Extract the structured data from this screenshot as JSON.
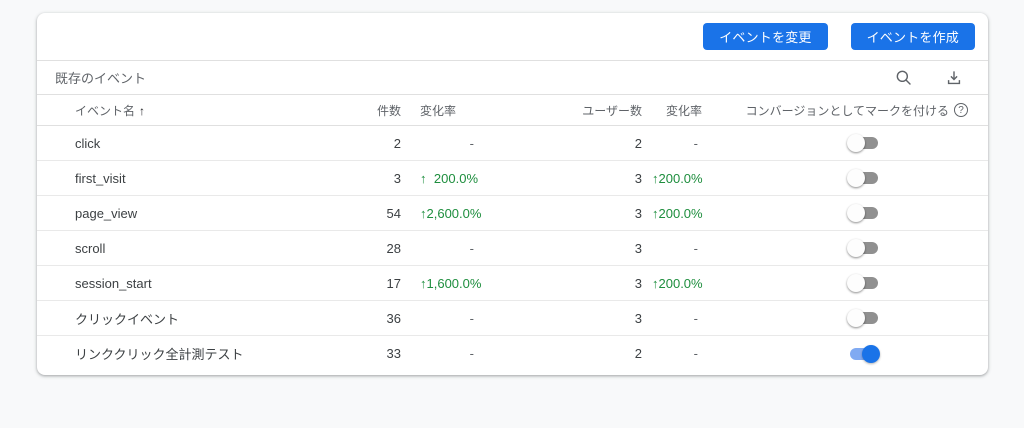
{
  "colors": {
    "accent_blue": "#1a73e8",
    "positive_green": "#1e8e3e",
    "toggle_on_track": "#80aaf2",
    "toggle_off_track": "#909090",
    "page_bg": "#f8f9fa"
  },
  "toolbar": {
    "modify_button_label": "イベントを変更",
    "create_button_label": "イベントを作成"
  },
  "subheader": {
    "title": "既存のイベント"
  },
  "table": {
    "header": {
      "event_name": "イベント名",
      "sort_arrow": "↑",
      "count": "件数",
      "count_change": "変化率",
      "users": "ユーザー数",
      "users_change": "変化率",
      "conversion": "コンバージョンとしてマークを付ける",
      "help_glyph": "?"
    },
    "up_arrow_glyph": "↑",
    "rows": [
      {
        "name": "click",
        "count": "2",
        "count_change": "-",
        "count_change_up": false,
        "users": "2",
        "users_change": "-",
        "users_change_up": false,
        "conversion_on": false
      },
      {
        "name": "first_visit",
        "count": "3",
        "count_change": "200.0%",
        "count_change_up": true,
        "users": "3",
        "users_change": "200.0%",
        "users_change_up": true,
        "conversion_on": false
      },
      {
        "name": "page_view",
        "count": "54",
        "count_change": "2,600.0%",
        "count_change_up": true,
        "users": "3",
        "users_change": "200.0%",
        "users_change_up": true,
        "conversion_on": false
      },
      {
        "name": "scroll",
        "count": "28",
        "count_change": "-",
        "count_change_up": false,
        "users": "3",
        "users_change": "-",
        "users_change_up": false,
        "conversion_on": false
      },
      {
        "name": "session_start",
        "count": "17",
        "count_change": "1,600.0%",
        "count_change_up": true,
        "users": "3",
        "users_change": "200.0%",
        "users_change_up": true,
        "conversion_on": false
      },
      {
        "name": "クリックイベント",
        "count": "36",
        "count_change": "-",
        "count_change_up": false,
        "users": "3",
        "users_change": "-",
        "users_change_up": false,
        "conversion_on": false
      },
      {
        "name": "リンククリック全計測テスト",
        "count": "33",
        "count_change": "-",
        "count_change_up": false,
        "users": "2",
        "users_change": "-",
        "users_change_up": false,
        "conversion_on": true
      }
    ]
  }
}
